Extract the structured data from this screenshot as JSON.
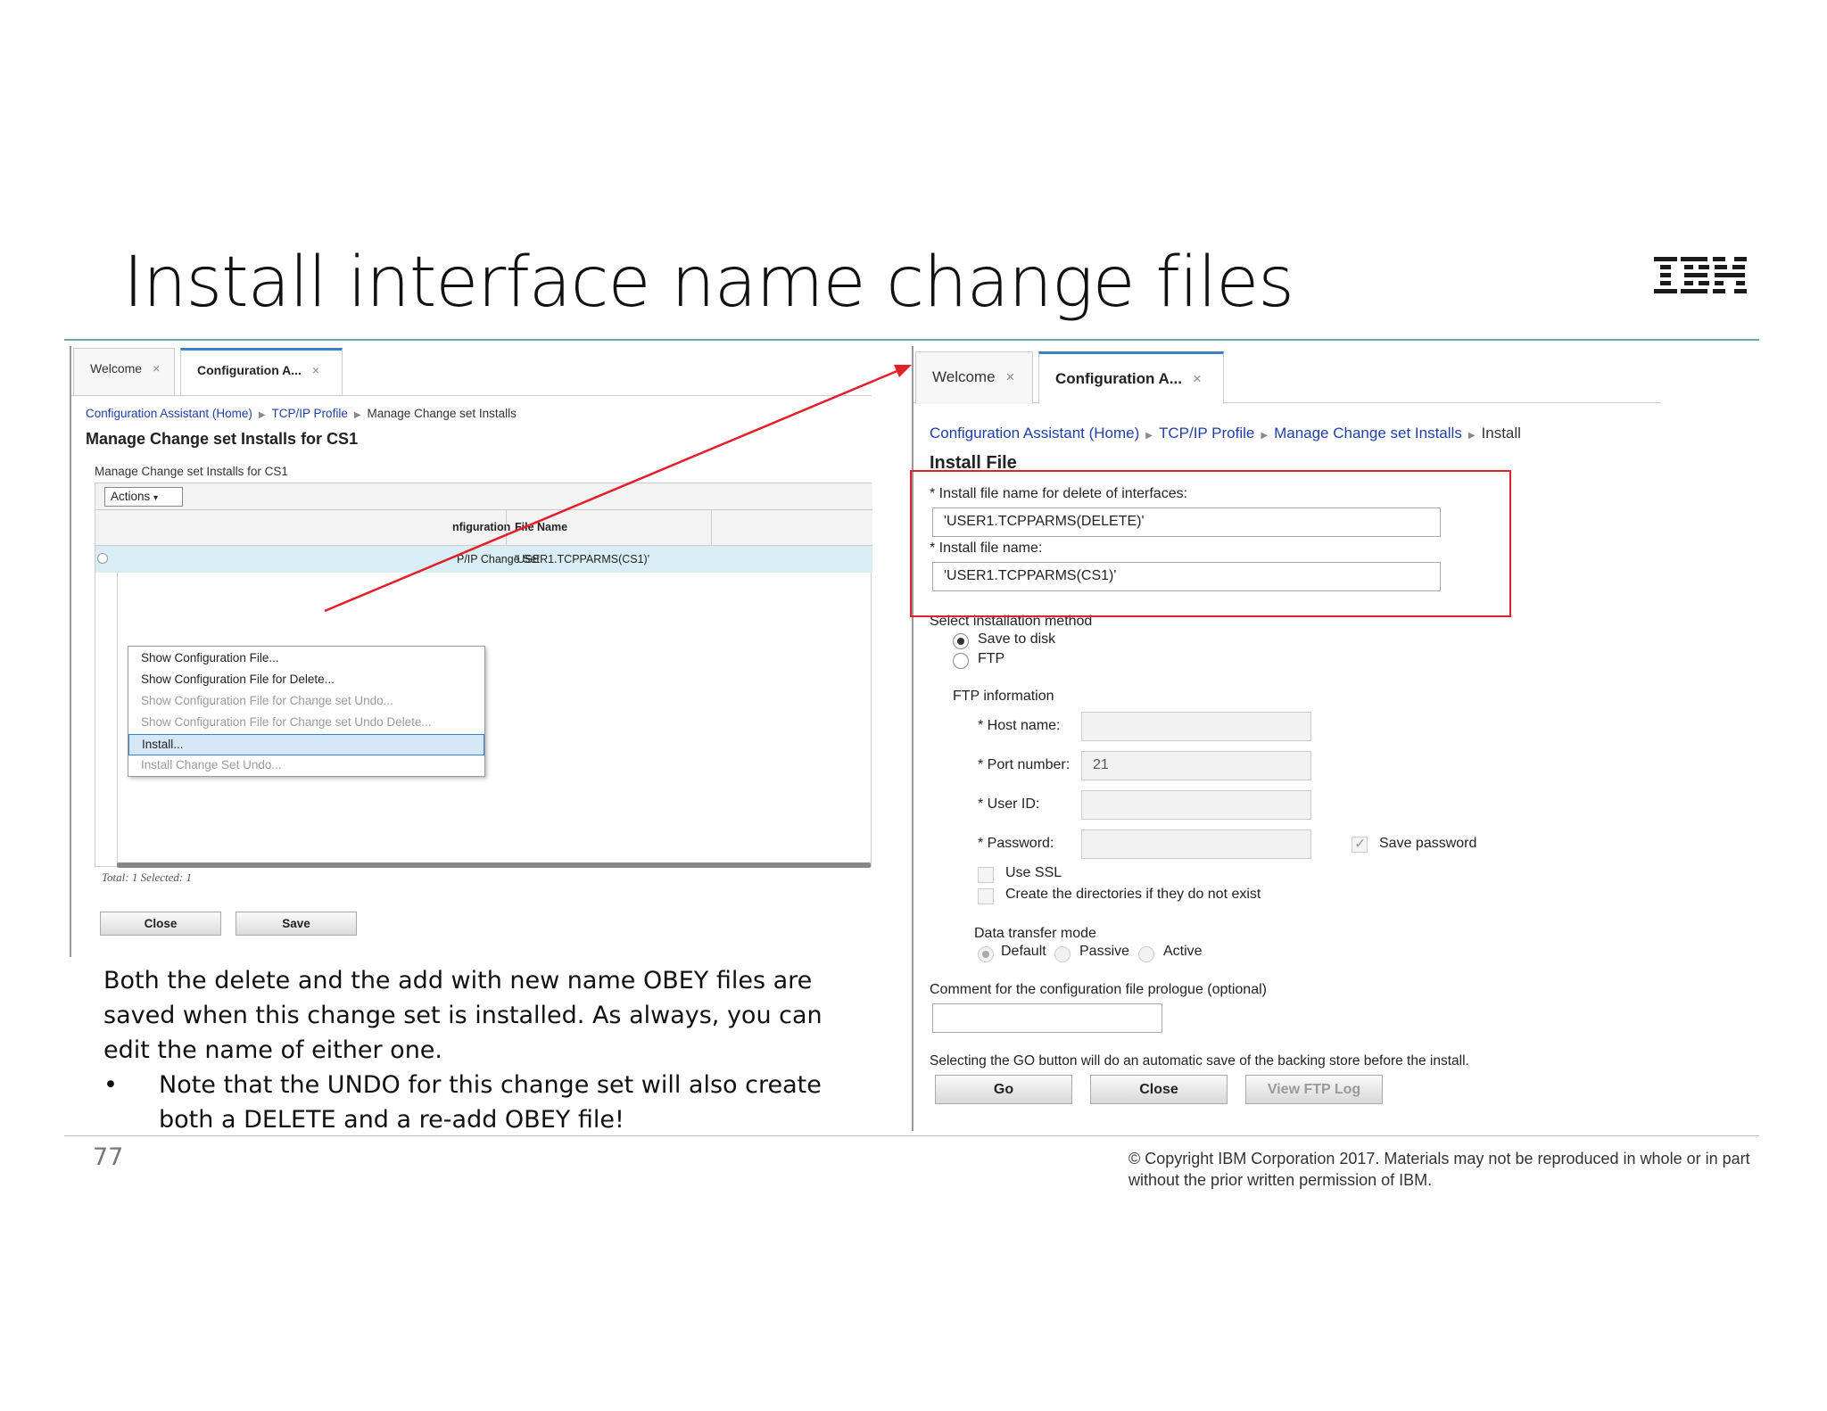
{
  "slide": {
    "title": "Install interface name change files",
    "page_number": "77",
    "copyright": "© Copyright IBM Corporation 2017.  Materials may not be reproduced in whole or in part without the prior written permission of IBM.",
    "logo_text": "IBM",
    "body_paragraph": "Both the delete and the add with new name OBEY files are saved when this change set is installed.  As always, you can edit the name of either one.",
    "bullet_glyph": "•",
    "bullet_text": "Note that the UNDO for this change set will also create both a DELETE and a re-add OBEY file!"
  },
  "left_screen": {
    "tabs": [
      {
        "label": "Welcome",
        "close": "×"
      },
      {
        "label": "Configuration A...",
        "close": "×"
      }
    ],
    "breadcrumb": [
      "Configuration Assistant (Home)",
      "TCP/IP Profile",
      "Manage Change set Installs"
    ],
    "breadcrumb_sep": "▶",
    "page_title": "Manage Change set Installs for CS1",
    "table_title": "Manage Change set Installs for CS1",
    "actions_label": "Actions",
    "actions_caret": "▾",
    "columns": [
      "nfiguration",
      "File Name"
    ],
    "row": {
      "config": "P/IP Change Set",
      "file_name": "'USER1.TCPPARMS(CS1)'"
    },
    "menu_items": [
      {
        "label": "Show Configuration File...",
        "disabled": false
      },
      {
        "label": "Show Configuration File for Delete...",
        "disabled": false
      },
      {
        "label": "Show Configuration File for Change set Undo...",
        "disabled": true
      },
      {
        "label": "Show Configuration File for Change set Undo Delete...",
        "disabled": true
      },
      {
        "label": "Install...",
        "disabled": false,
        "selected": true
      },
      {
        "label": "Install Change Set Undo...",
        "disabled": true
      }
    ],
    "total_text": "Total: 1 Selected: 1",
    "close_button": "Close",
    "save_button": "Save"
  },
  "right_screen": {
    "tabs": [
      {
        "label": "Welcome",
        "close": "×"
      },
      {
        "label": "Configuration A...",
        "close": "×"
      }
    ],
    "breadcrumb": [
      "Configuration Assistant (Home)",
      "TCP/IP Profile",
      "Manage Change set Installs",
      "Install"
    ],
    "breadcrumb_sep": "▶",
    "page_title": "Install File",
    "delete_file_label": "* Install file name for delete of interfaces:",
    "delete_file_value": "'USER1.TCPPARMS(DELETE)'",
    "install_file_label": "* Install file name:",
    "install_file_value": "'USER1.TCPPARMS(CS1)'",
    "method_label": "Select installation method",
    "method_options": [
      {
        "label": "Save to disk",
        "checked": true
      },
      {
        "label": "FTP",
        "checked": false
      }
    ],
    "ftp_info_label": "FTP information",
    "host_label": "* Host name:",
    "host_value": "",
    "port_label": "* Port number:",
    "port_value": "21",
    "userid_label": "* User ID:",
    "userid_value": "",
    "password_label": "* Password:",
    "password_value": "",
    "save_password_label": "Save password",
    "save_password_checked": true,
    "use_ssl_label": "Use SSL",
    "create_dirs_label": "Create the directories if they do not exist",
    "transfer_mode_label": "Data transfer mode",
    "transfer_modes": [
      {
        "label": "Default",
        "checked": true
      },
      {
        "label": "Passive",
        "checked": false
      },
      {
        "label": "Active",
        "checked": false
      }
    ],
    "comment_label": "Comment for the configuration file prologue (optional)",
    "comment_value": "",
    "go_note": "Selecting the GO button will do an automatic save of the backing store before the install.",
    "go_button": "Go",
    "close_button": "Close",
    "ftp_log_button": "View FTP Log"
  },
  "colors": {
    "arrow": "#e2202a",
    "highlight_box": "#e2202a",
    "link": "#1f3fa8",
    "tab_accent": "#3b83c4",
    "rule": "#6aa9b0"
  }
}
